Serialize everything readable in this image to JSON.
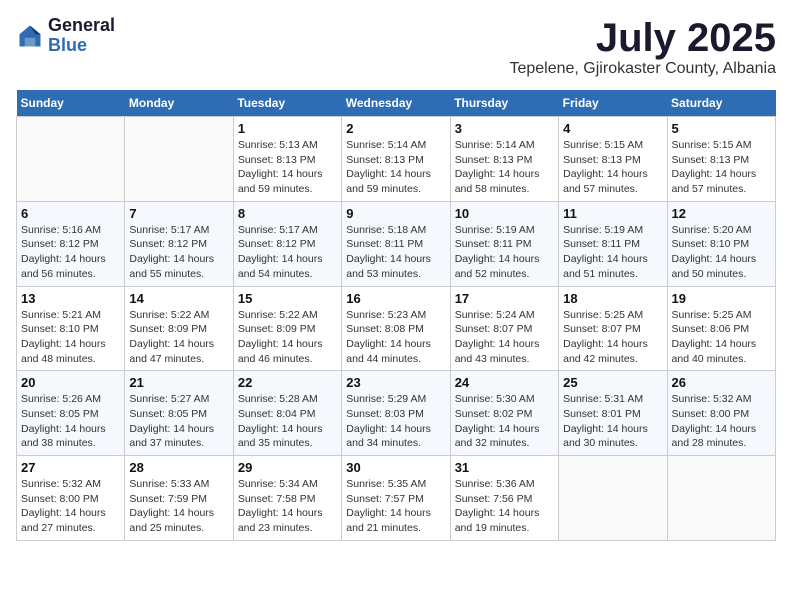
{
  "logo": {
    "general": "General",
    "blue": "Blue"
  },
  "title": "July 2025",
  "location": "Tepelene, Gjirokaster County, Albania",
  "weekdays": [
    "Sunday",
    "Monday",
    "Tuesday",
    "Wednesday",
    "Thursday",
    "Friday",
    "Saturday"
  ],
  "weeks": [
    [
      {
        "day": "",
        "sunrise": "",
        "sunset": "",
        "daylight": ""
      },
      {
        "day": "",
        "sunrise": "",
        "sunset": "",
        "daylight": ""
      },
      {
        "day": "1",
        "sunrise": "Sunrise: 5:13 AM",
        "sunset": "Sunset: 8:13 PM",
        "daylight": "Daylight: 14 hours and 59 minutes."
      },
      {
        "day": "2",
        "sunrise": "Sunrise: 5:14 AM",
        "sunset": "Sunset: 8:13 PM",
        "daylight": "Daylight: 14 hours and 59 minutes."
      },
      {
        "day": "3",
        "sunrise": "Sunrise: 5:14 AM",
        "sunset": "Sunset: 8:13 PM",
        "daylight": "Daylight: 14 hours and 58 minutes."
      },
      {
        "day": "4",
        "sunrise": "Sunrise: 5:15 AM",
        "sunset": "Sunset: 8:13 PM",
        "daylight": "Daylight: 14 hours and 57 minutes."
      },
      {
        "day": "5",
        "sunrise": "Sunrise: 5:15 AM",
        "sunset": "Sunset: 8:13 PM",
        "daylight": "Daylight: 14 hours and 57 minutes."
      }
    ],
    [
      {
        "day": "6",
        "sunrise": "Sunrise: 5:16 AM",
        "sunset": "Sunset: 8:12 PM",
        "daylight": "Daylight: 14 hours and 56 minutes."
      },
      {
        "day": "7",
        "sunrise": "Sunrise: 5:17 AM",
        "sunset": "Sunset: 8:12 PM",
        "daylight": "Daylight: 14 hours and 55 minutes."
      },
      {
        "day": "8",
        "sunrise": "Sunrise: 5:17 AM",
        "sunset": "Sunset: 8:12 PM",
        "daylight": "Daylight: 14 hours and 54 minutes."
      },
      {
        "day": "9",
        "sunrise": "Sunrise: 5:18 AM",
        "sunset": "Sunset: 8:11 PM",
        "daylight": "Daylight: 14 hours and 53 minutes."
      },
      {
        "day": "10",
        "sunrise": "Sunrise: 5:19 AM",
        "sunset": "Sunset: 8:11 PM",
        "daylight": "Daylight: 14 hours and 52 minutes."
      },
      {
        "day": "11",
        "sunrise": "Sunrise: 5:19 AM",
        "sunset": "Sunset: 8:11 PM",
        "daylight": "Daylight: 14 hours and 51 minutes."
      },
      {
        "day": "12",
        "sunrise": "Sunrise: 5:20 AM",
        "sunset": "Sunset: 8:10 PM",
        "daylight": "Daylight: 14 hours and 50 minutes."
      }
    ],
    [
      {
        "day": "13",
        "sunrise": "Sunrise: 5:21 AM",
        "sunset": "Sunset: 8:10 PM",
        "daylight": "Daylight: 14 hours and 48 minutes."
      },
      {
        "day": "14",
        "sunrise": "Sunrise: 5:22 AM",
        "sunset": "Sunset: 8:09 PM",
        "daylight": "Daylight: 14 hours and 47 minutes."
      },
      {
        "day": "15",
        "sunrise": "Sunrise: 5:22 AM",
        "sunset": "Sunset: 8:09 PM",
        "daylight": "Daylight: 14 hours and 46 minutes."
      },
      {
        "day": "16",
        "sunrise": "Sunrise: 5:23 AM",
        "sunset": "Sunset: 8:08 PM",
        "daylight": "Daylight: 14 hours and 44 minutes."
      },
      {
        "day": "17",
        "sunrise": "Sunrise: 5:24 AM",
        "sunset": "Sunset: 8:07 PM",
        "daylight": "Daylight: 14 hours and 43 minutes."
      },
      {
        "day": "18",
        "sunrise": "Sunrise: 5:25 AM",
        "sunset": "Sunset: 8:07 PM",
        "daylight": "Daylight: 14 hours and 42 minutes."
      },
      {
        "day": "19",
        "sunrise": "Sunrise: 5:25 AM",
        "sunset": "Sunset: 8:06 PM",
        "daylight": "Daylight: 14 hours and 40 minutes."
      }
    ],
    [
      {
        "day": "20",
        "sunrise": "Sunrise: 5:26 AM",
        "sunset": "Sunset: 8:05 PM",
        "daylight": "Daylight: 14 hours and 38 minutes."
      },
      {
        "day": "21",
        "sunrise": "Sunrise: 5:27 AM",
        "sunset": "Sunset: 8:05 PM",
        "daylight": "Daylight: 14 hours and 37 minutes."
      },
      {
        "day": "22",
        "sunrise": "Sunrise: 5:28 AM",
        "sunset": "Sunset: 8:04 PM",
        "daylight": "Daylight: 14 hours and 35 minutes."
      },
      {
        "day": "23",
        "sunrise": "Sunrise: 5:29 AM",
        "sunset": "Sunset: 8:03 PM",
        "daylight": "Daylight: 14 hours and 34 minutes."
      },
      {
        "day": "24",
        "sunrise": "Sunrise: 5:30 AM",
        "sunset": "Sunset: 8:02 PM",
        "daylight": "Daylight: 14 hours and 32 minutes."
      },
      {
        "day": "25",
        "sunrise": "Sunrise: 5:31 AM",
        "sunset": "Sunset: 8:01 PM",
        "daylight": "Daylight: 14 hours and 30 minutes."
      },
      {
        "day": "26",
        "sunrise": "Sunrise: 5:32 AM",
        "sunset": "Sunset: 8:00 PM",
        "daylight": "Daylight: 14 hours and 28 minutes."
      }
    ],
    [
      {
        "day": "27",
        "sunrise": "Sunrise: 5:32 AM",
        "sunset": "Sunset: 8:00 PM",
        "daylight": "Daylight: 14 hours and 27 minutes."
      },
      {
        "day": "28",
        "sunrise": "Sunrise: 5:33 AM",
        "sunset": "Sunset: 7:59 PM",
        "daylight": "Daylight: 14 hours and 25 minutes."
      },
      {
        "day": "29",
        "sunrise": "Sunrise: 5:34 AM",
        "sunset": "Sunset: 7:58 PM",
        "daylight": "Daylight: 14 hours and 23 minutes."
      },
      {
        "day": "30",
        "sunrise": "Sunrise: 5:35 AM",
        "sunset": "Sunset: 7:57 PM",
        "daylight": "Daylight: 14 hours and 21 minutes."
      },
      {
        "day": "31",
        "sunrise": "Sunrise: 5:36 AM",
        "sunset": "Sunset: 7:56 PM",
        "daylight": "Daylight: 14 hours and 19 minutes."
      },
      {
        "day": "",
        "sunrise": "",
        "sunset": "",
        "daylight": ""
      },
      {
        "day": "",
        "sunrise": "",
        "sunset": "",
        "daylight": ""
      }
    ]
  ]
}
